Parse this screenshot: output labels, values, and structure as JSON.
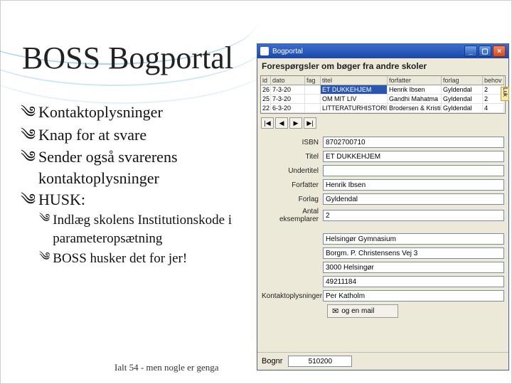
{
  "slide": {
    "title": "BOSS Bogportal",
    "bullets": [
      "Kontaktoplysninger",
      "Knap for at svare",
      "Sender også svarerens kontaktoplysninger",
      "HUSK:"
    ],
    "subbullets": [
      "Indlæg skolens Institutionskode i parameteropsætning",
      "BOSS husker det for jer!"
    ],
    "footer": "Ialt 54 - men nogle er genga"
  },
  "window": {
    "title": "Bogportal",
    "heading": "Forespørgsler om bøger fra andre skoler",
    "sidetab": "Luk",
    "columns": [
      "id",
      "dato",
      "fag",
      "titel",
      "forfatter",
      "forlag",
      "behov"
    ],
    "rows": [
      {
        "id": "26",
        "dato": "7-3-20",
        "fag": "",
        "titel": "ET DUKKEHJEM",
        "forfatter": "Henrik Ibsen",
        "forlag": "Gyldendal",
        "behov": "2"
      },
      {
        "id": "25",
        "dato": "7-3-20",
        "fag": "",
        "titel": "OM MIT LIV",
        "forfatter": "Gandhi Mahatma",
        "forlag": "Gyldendal",
        "behov": "2"
      },
      {
        "id": "22",
        "dato": "6-3-20",
        "fag": "",
        "titel": "LITTERATURHISTORIE - NOTE",
        "forfatter": "Brodersen & Kristiansen",
        "forlag": "Gyldendal",
        "behov": "4"
      }
    ],
    "nav": [
      "|◀",
      "◀",
      "▶",
      "▶|"
    ],
    "form": {
      "isbn_label": "ISBN",
      "isbn": "8702700710",
      "titel_label": "Titel",
      "titel": "ET DUKKEHJEM",
      "undertitel_label": "Undertitel",
      "undertitel": "",
      "forfatter_label": "Forfatter",
      "forfatter": "Henrik Ibsen",
      "forlag_label": "Forlag",
      "forlag": "Gyldendal",
      "antal_label": "Antal eksemplarer",
      "antal": "2",
      "skole_label": "",
      "skole": "Helsingør Gymnasium",
      "adr_label": "",
      "adr": "Borgm. P. Christensens Vej 3",
      "post_label": "",
      "post": "3000 Helsingør",
      "tlf_label": "",
      "tlf": "49211184",
      "kontakt_label": "Kontaktoplysninger",
      "kontakt": "Per Katholm",
      "mail_button": "og en mail"
    },
    "bottom": {
      "label": "Bognr",
      "value": "510200"
    }
  }
}
